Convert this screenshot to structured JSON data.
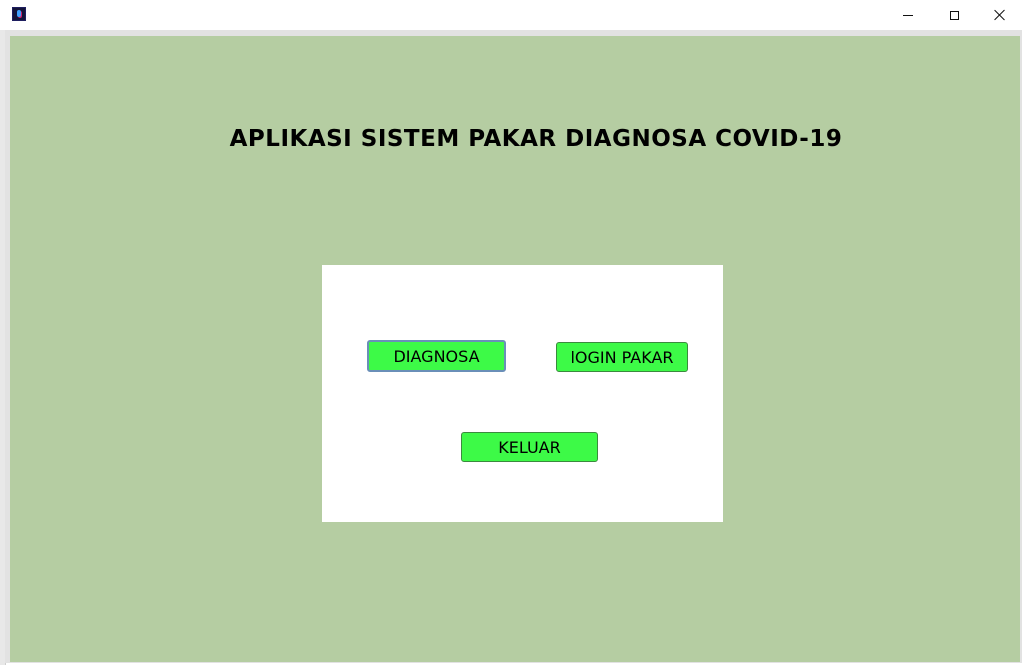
{
  "window": {
    "icon": "java-app-icon",
    "controls": {
      "minimize": "minimize-icon",
      "maximize": "maximize-icon",
      "close": "close-icon"
    }
  },
  "main": {
    "title": "APLIKASI SISTEM PAKAR DIAGNOSA COVID-19",
    "background_color": "#b5cda2",
    "panel_color": "#ffffff",
    "button_color": "#3dfa47"
  },
  "buttons": {
    "diagnosa": "DIAGNOSA",
    "login": "lOGIN PAKAR",
    "keluar": "KELUAR"
  }
}
